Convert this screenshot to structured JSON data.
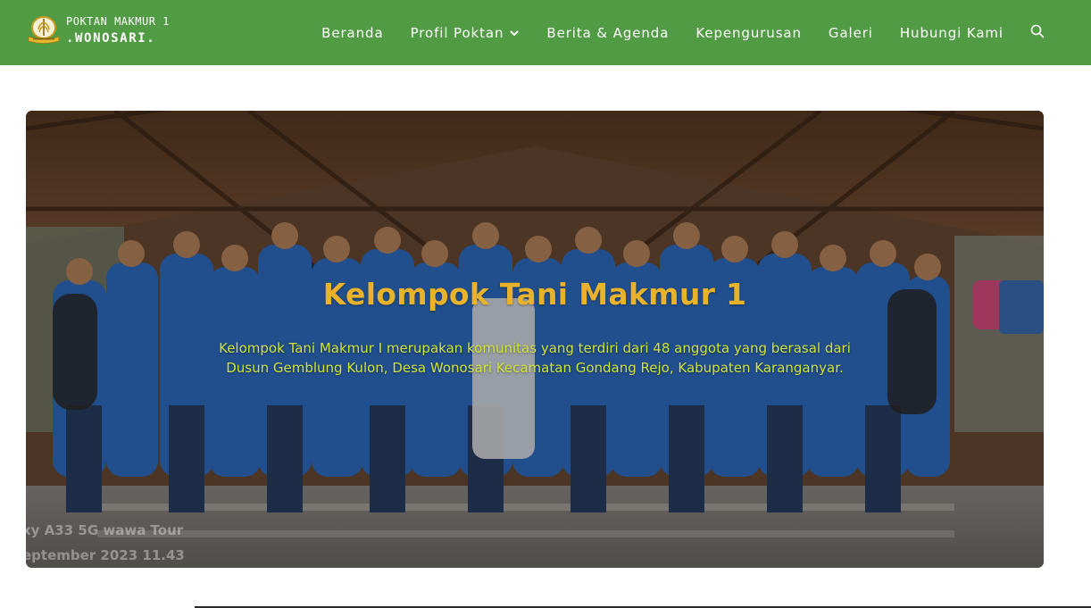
{
  "brand": {
    "line1": "POKTAN MAKMUR 1",
    "line2": ".WONOSARI.",
    "logo_icon": "rice-sheaf-emblem-icon"
  },
  "nav": {
    "items": [
      {
        "label": "Beranda"
      },
      {
        "label": "Profil Poktan",
        "has_dropdown": true
      },
      {
        "label": "Berita & Agenda"
      },
      {
        "label": "Kepengurusan"
      },
      {
        "label": "Galeri"
      },
      {
        "label": "Hubungi Kami"
      }
    ],
    "search_icon": "search-icon"
  },
  "hero": {
    "title": "Kelompok Tani Makmur 1",
    "description": "Kelompok Tani Makmur I merupakan komunitas yang terdiri dari 48 anggota yang berasal dari Dusun Gemblung Kulon, Desa Wonosari Kecamatan Gondang Rejo, Kabupaten Karanganyar.",
    "watermark_line1": "xy A33 5G wawa Tour",
    "watermark_line2": "eptember 2023 11.43"
  },
  "colors": {
    "navbar": "#509b43",
    "title": "#e8b32a",
    "description": "#cfe33a"
  }
}
